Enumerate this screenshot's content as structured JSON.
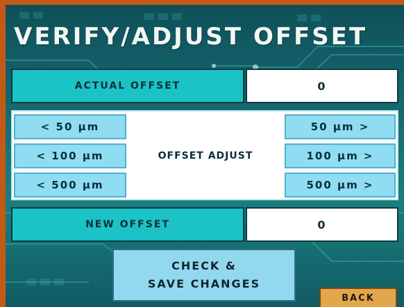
{
  "screen": {
    "title": "VERIFY/ADJUST OFFSET"
  },
  "actual_offset": {
    "label": "ACTUAL OFFSET",
    "value": "0"
  },
  "offset_adjust": {
    "label": "OFFSET ADJUST",
    "decrease_buttons": [
      "< 50 μm",
      "< 100 μm",
      "< 500 μm"
    ],
    "increase_buttons": [
      "50 μm >",
      "100 μm >",
      "500 μm >"
    ]
  },
  "new_offset": {
    "label": "NEW OFFSET",
    "value": "0"
  },
  "actions": {
    "check_line1": "CHECK &",
    "check_line2": "SAVE CHANGES",
    "back": "BACK"
  },
  "colors": {
    "frame": "#c25a16",
    "background": "#176e72",
    "label_teal": "#1bc3c6",
    "adjust_button": "#8fdcf3",
    "back_button": "#e3a64b"
  }
}
